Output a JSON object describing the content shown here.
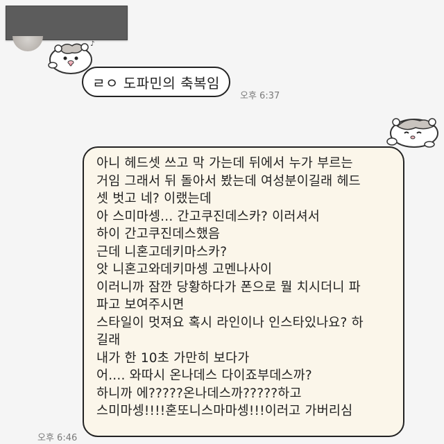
{
  "chat": {
    "incoming": {
      "text": "ㄹㅇ 도파민의 축복임",
      "time": "오후 6:37"
    },
    "outgoing": {
      "lines": [
        "아니 헤드셋 쓰고 막 가는데 뒤에서 누가 부르는",
        "거임 그래서 뒤 돌아서 봤는데 여성분이길래 헤드",
        "셋 벗고 네? 이랬는데",
        "아 스미마셍... 간고쿠진데스카? 이러셔서",
        "하이 간고쿠진데스했음",
        "근데 니혼고데키마스카?",
        "앗 니혼고와데키마셍 고멘나사이",
        "이러니까 잠깐 당황하다가 폰으로 뭘 치시더니 파",
        "파고 보여주시면",
        "스타일이 멋져요 혹시 라인이나 인스타있나요? 하",
        "길래",
        "내가 한 10초 가만히 보다가",
        "어.... 와따시 온나데스 다이죠부데스까?",
        "하니까 에?????온나데스까?????하고",
        "스미마셍!!!!혼또니스마마셍!!!이러고 가버리심"
      ],
      "time": "오후 6:46"
    },
    "colors": {
      "background": "#f5f5f5",
      "incoming_bubble": "#ffffff",
      "outgoing_bubble": "#fbf6ea",
      "bubble_border": "#222222",
      "timestamp": "#7a7a7a",
      "redaction": "#5c5c5c"
    },
    "stickers": [
      "hamster-sticker",
      "hamster-sticker"
    ]
  }
}
